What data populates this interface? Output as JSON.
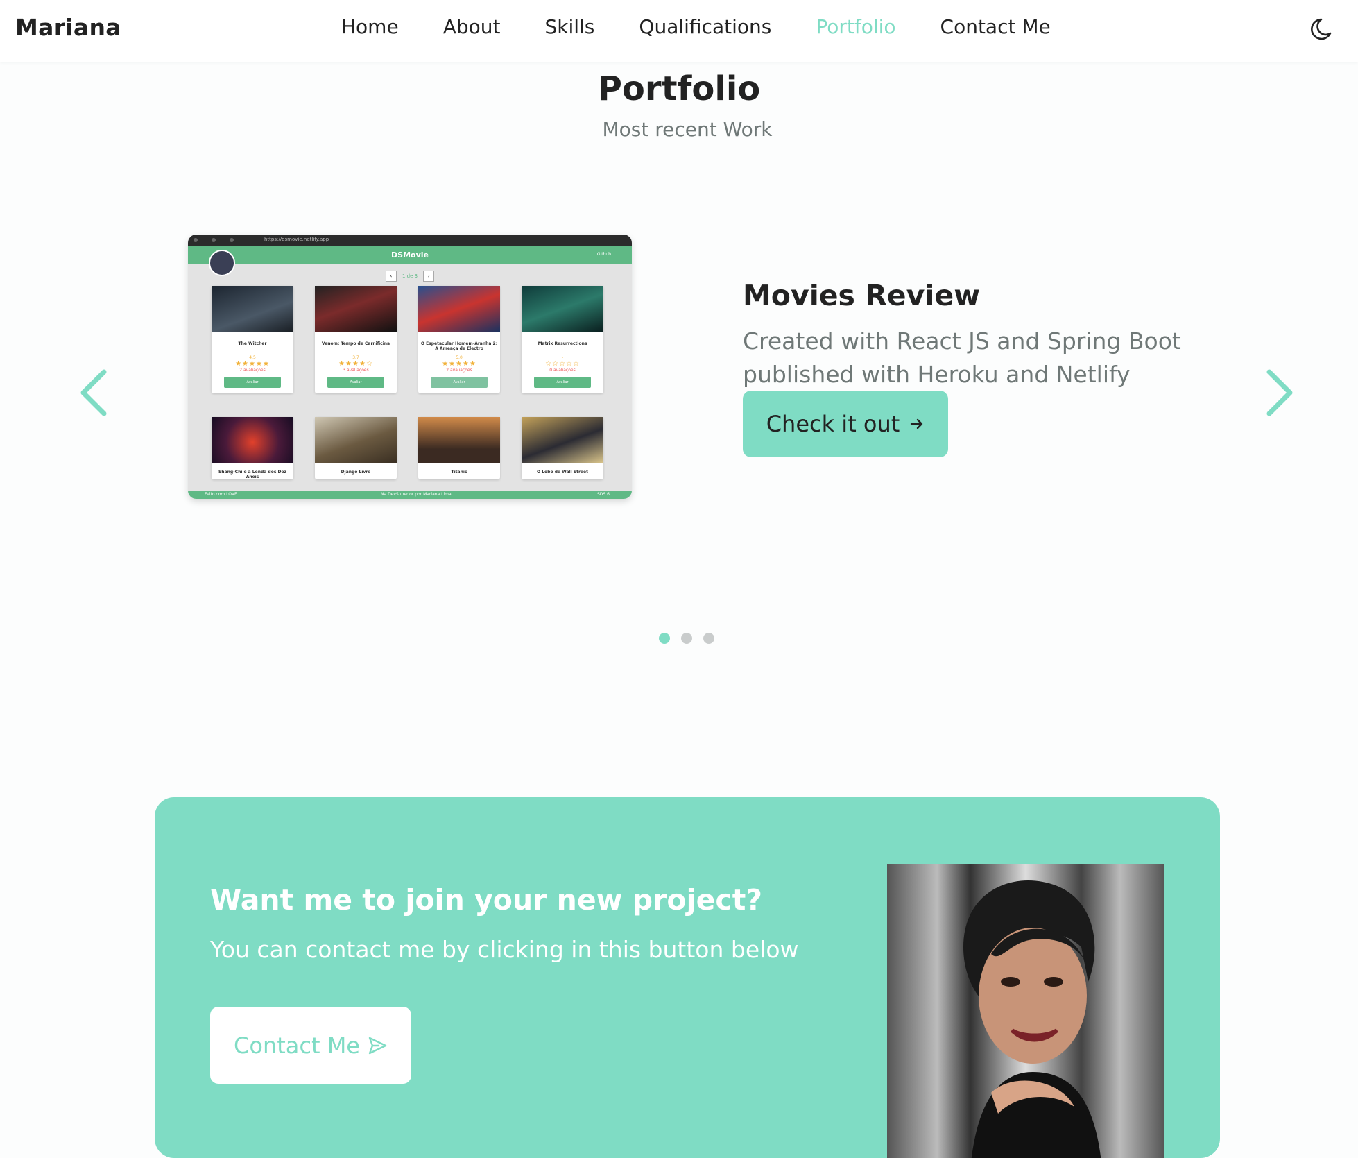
{
  "header": {
    "logo": "Mariana",
    "nav": [
      "Home",
      "About",
      "Skills",
      "Qualifications",
      "Portfolio",
      "Contact Me"
    ],
    "active_nav": "Portfolio",
    "theme_toggle_icon": "moon-icon"
  },
  "section": {
    "title": "Portfolio",
    "subtitle": "Most recent Work"
  },
  "project": {
    "title": "Movies Review",
    "description_line1": "Created with React JS and Spring Boot",
    "description_line2": "published with Heroku and Netlify",
    "button_label": "Check it out",
    "button_icon": "arrow-right-icon",
    "screenshot": {
      "url": "https://dsmovie.netlify.app",
      "app_name": "DSMovie",
      "github_label": "Github",
      "pager_text": "1 de 3",
      "footer_left": "Feito com LOVE",
      "footer_center": "Na DevSuperior por Mariana Lima",
      "footer_right": "SDS 6",
      "movies": [
        {
          "title": "The Witcher",
          "score": "4.5",
          "stars": "★★★★★",
          "count": "2 avaliações",
          "button": "Avaliar"
        },
        {
          "title": "Venom: Tempo de Carnificina",
          "score": "3.7",
          "stars": "★★★★☆",
          "count": "3 avaliações",
          "button": "Avaliar"
        },
        {
          "title": "O Espetacular Homem-Aranha 2: A Ameaça de Electro",
          "score": "5.0",
          "stars": "★★★★★",
          "count": "2 avaliações",
          "button": "Avaliar"
        },
        {
          "title": "Matrix Resurrections",
          "score": "-",
          "stars": "☆☆☆☆☆",
          "count": "0 avaliações",
          "button": "Avaliar"
        },
        {
          "title": "Shang-Chi e a Lenda dos Dez Anéis"
        },
        {
          "title": "Django Livre"
        },
        {
          "title": "Titanic"
        },
        {
          "title": "O Lobo de Wall Street"
        }
      ]
    }
  },
  "carousel": {
    "slides": 3,
    "active_index": 0,
    "prev_icon": "chevron-left-icon",
    "next_icon": "chevron-right-icon"
  },
  "banner": {
    "title": "Want me to join your new project?",
    "subtitle": "You can contact me by clicking in this button below",
    "button_label": "Contact Me",
    "button_icon": "send-icon"
  },
  "colors": {
    "accent": "#7fdcc4",
    "text": "#222222",
    "muted": "#6f7877",
    "app_green": "#5fb985"
  }
}
